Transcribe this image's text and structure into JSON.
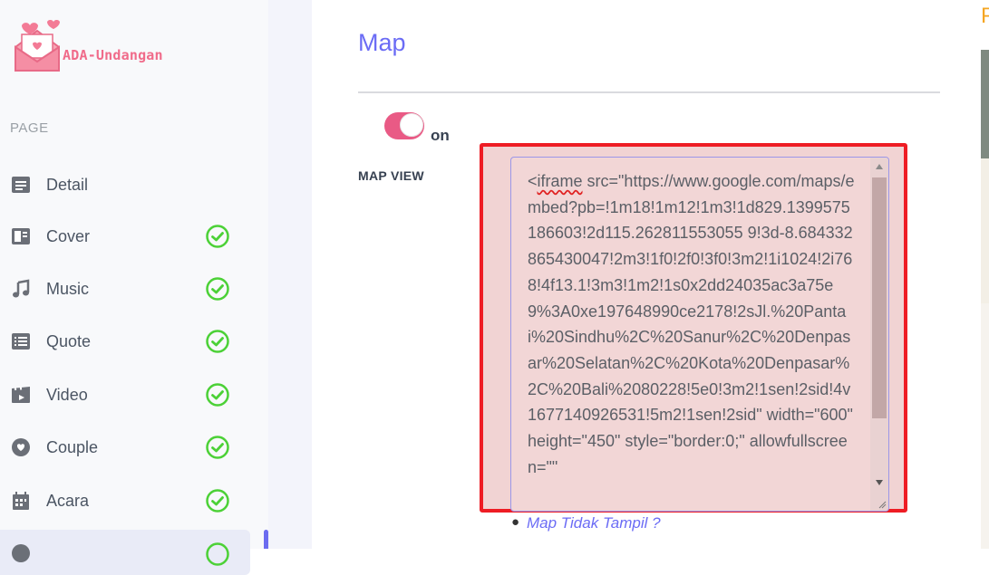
{
  "brand": {
    "name": "ADA-Undangan"
  },
  "sidebar": {
    "section_label": "PAGE",
    "items": [
      {
        "label": "Detail",
        "icon": "document-icon",
        "completed": false
      },
      {
        "label": "Cover",
        "icon": "cover-layout-icon",
        "completed": true
      },
      {
        "label": "Music",
        "icon": "music-note-icon",
        "completed": true
      },
      {
        "label": "Quote",
        "icon": "list-icon",
        "completed": true
      },
      {
        "label": "Video",
        "icon": "film-icon",
        "completed": true
      },
      {
        "label": "Couple",
        "icon": "heart-icon",
        "completed": true
      },
      {
        "label": "Acara",
        "icon": "calendar-icon",
        "completed": true
      },
      {
        "label": "",
        "icon": "map-pin-icon",
        "completed": true,
        "active": true
      }
    ]
  },
  "main": {
    "title": "Map",
    "toggle": {
      "state": "on",
      "label": "on"
    },
    "map_field": {
      "label": "MAP VIEW",
      "value_spellmark": "iframe",
      "value_rest": " src=\"https://www.google.com/maps/embed?pb=!1m18!1m12!1m3!1d829.1399575186603!2d115.262811553055 9!3d-8.684332865430047!2m3!1f0!2f0!3f0!3m2!1i1024!2i768!4f13.1!3m3!1m2!1s0x2dd24035ac3a75e9%3A0xe197648990ce2178!2sJl.%20Pantai%20Sindhu%2C%20Sanur%2C%20Denpasar%20Selatan%2C%20Kota%20Denpasar%2C%20Bali%2080228!5e0!3m2!1sen!2sid!4v1677140926531!5m2!1sen!2sid\" width=\"600\" height=\"450\" style=\"border:0;\" allowfullscreen=\"\""
    },
    "help_link": "Map Tidak Tampil ?"
  },
  "colors": {
    "accent": "#6b6cf5",
    "toggle_on": "#e95a85",
    "check": "#4cd137",
    "highlight_border": "#ee1c24"
  }
}
